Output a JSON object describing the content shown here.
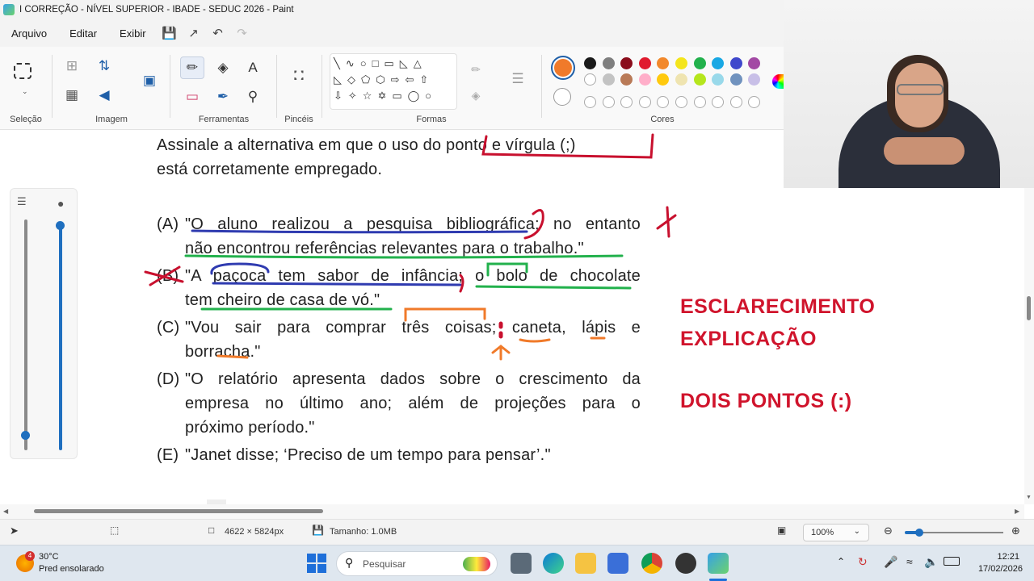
{
  "window": {
    "title": "I CORREÇÃO - NÍVEL SUPERIOR - IBADE - SEDUC 2026 - Paint"
  },
  "menu": {
    "items": [
      "Arquivo",
      "Editar",
      "Exibir"
    ]
  },
  "ribbon": {
    "groups": {
      "selecao": "Seleção",
      "imagem": "Imagem",
      "ferramentas": "Ferramentas",
      "pinceis": "Pincéis",
      "formas": "Formas",
      "cores": "Cores"
    }
  },
  "colors": {
    "current_primary": "#f07a2a",
    "current_secondary": "#ffffff",
    "row1": [
      "#1a1a1a",
      "#7f7f7f",
      "#8b0d1c",
      "#e01b2e",
      "#f2892c",
      "#f4e51c",
      "#22b14c",
      "#19a8e4",
      "#3f48cc",
      "#a349a4"
    ],
    "row2": [
      "#ffffff",
      "#c3c3c3",
      "#b97a57",
      "#ffaec9",
      "#ffc90e",
      "#efe4b0",
      "#b5e61d",
      "#99d9ea",
      "#7092be",
      "#c8bfe7"
    ]
  },
  "document": {
    "question_line1": "Assinale a alternativa em que o uso do ponto e vírgula (;)",
    "question_line2": "está corretamente empregado.",
    "options": [
      {
        "letter": "(A)",
        "line1": "\"O aluno realizou a pesquisa bibliográfica; no entanto",
        "line2": "não encontrou referências relevantes para o trabalho.\""
      },
      {
        "letter": "(B)",
        "line1": "\"A paçoca tem sabor de infância; o bolo de chocolate",
        "line2": "tem cheiro de casa de vó.\""
      },
      {
        "letter": "(C)",
        "line1": "\"Vou sair para comprar três coisas; caneta, lápis e",
        "line2": "borracha.\""
      },
      {
        "letter": "(D)",
        "line1": "\"O relatório apresenta dados sobre o crescimento da",
        "line2": "empresa no último ano; além de projeções para o",
        "line3": "próximo período.\""
      },
      {
        "letter": "(E)",
        "line1": "\"Janet disse; ‘Preciso de um tempo para pensar’.\""
      }
    ],
    "notes": {
      "line1": "ESCLARECIMENTO",
      "line2": "EXPLICAÇÃO",
      "line3": "DOIS PONTOS (:)"
    }
  },
  "status": {
    "dimensions": "4622 × 5824px",
    "size": "Tamanho: 1.0MB",
    "zoom": "100%"
  },
  "taskbar": {
    "weather_temp": "30°C",
    "weather_desc": "Pred ensolarado",
    "weather_badge": "4",
    "search_placeholder": "Pesquisar",
    "time": "12:21",
    "date": "17/02/2026"
  }
}
